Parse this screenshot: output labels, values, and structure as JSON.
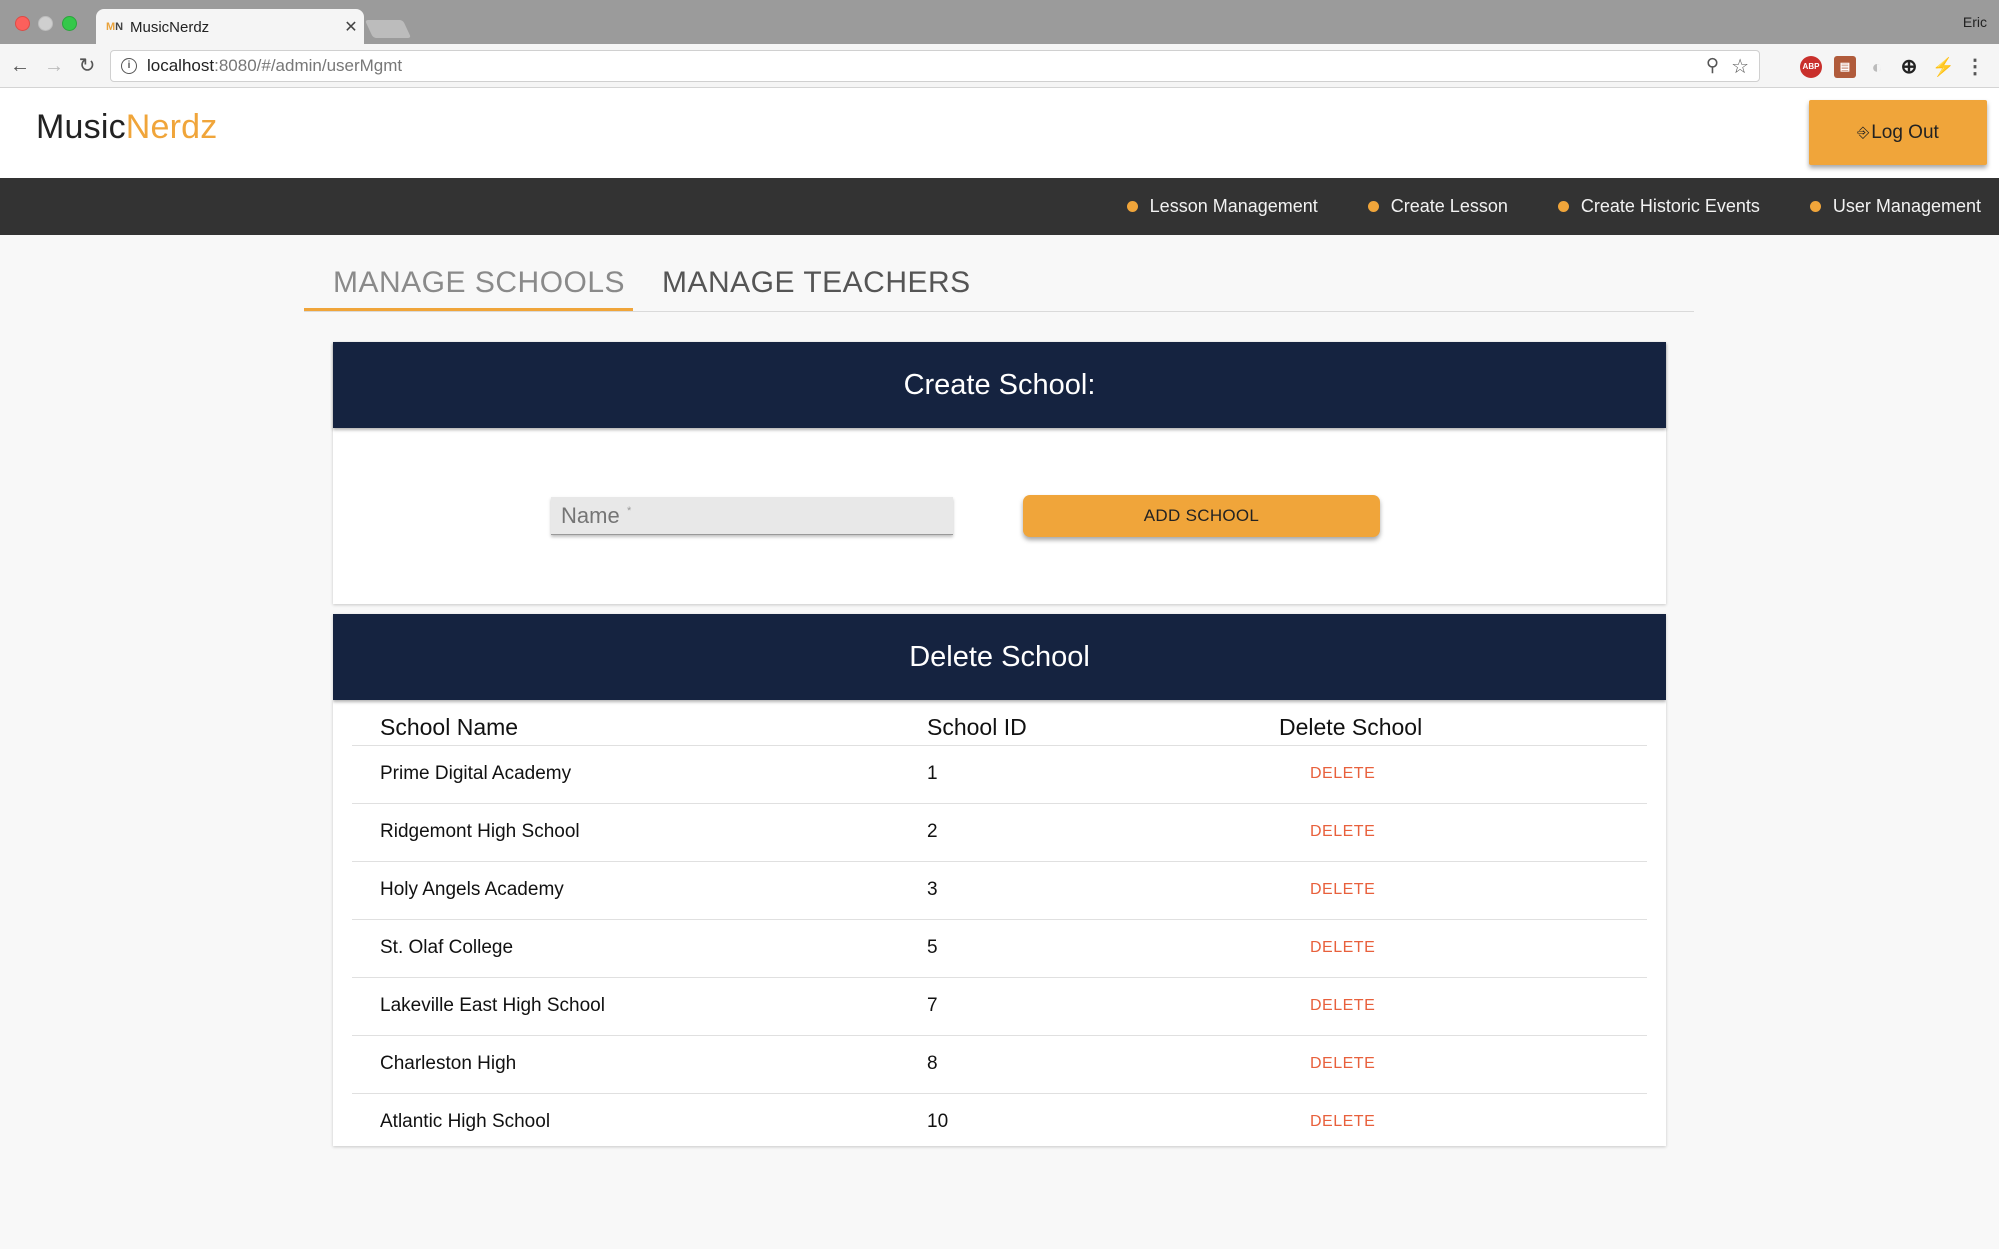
{
  "browser": {
    "tab_title": "MusicNerdz",
    "tab_favicon_m": "M",
    "tab_favicon_n": "N",
    "profile": "Eric",
    "url_host": "localhost",
    "url_path": ":8080/#/admin/userMgmt"
  },
  "header": {
    "logo_main": "Music",
    "logo_accent": "Nerdz",
    "logout_label": "Log Out"
  },
  "nav": {
    "items": [
      {
        "label": "Lesson Management"
      },
      {
        "label": "Create Lesson"
      },
      {
        "label": "Create Historic Events"
      },
      {
        "label": "User Management"
      }
    ]
  },
  "tabs": {
    "schools": "MANAGE SCHOOLS",
    "teachers": "MANAGE TEACHERS"
  },
  "create": {
    "title": "Create School:",
    "name_placeholder": "Name",
    "required_mark": "*",
    "add_button": "ADD SCHOOL"
  },
  "delete": {
    "title": "Delete School",
    "columns": [
      "School Name",
      "School ID",
      "Delete School"
    ],
    "delete_label": "DELETE",
    "rows": [
      {
        "name": "Prime Digital Academy",
        "id": "1"
      },
      {
        "name": "Ridgemont High School",
        "id": "2"
      },
      {
        "name": "Holy Angels Academy",
        "id": "3"
      },
      {
        "name": "St. Olaf College",
        "id": "5"
      },
      {
        "name": "Lakeville East High School",
        "id": "7"
      },
      {
        "name": "Charleston High",
        "id": "8"
      },
      {
        "name": "Atlantic High School",
        "id": "10"
      }
    ]
  },
  "colors": {
    "accent": "#f0a53a",
    "navy": "#152340",
    "nav_bar": "#333333",
    "delete": "#e8603c"
  }
}
